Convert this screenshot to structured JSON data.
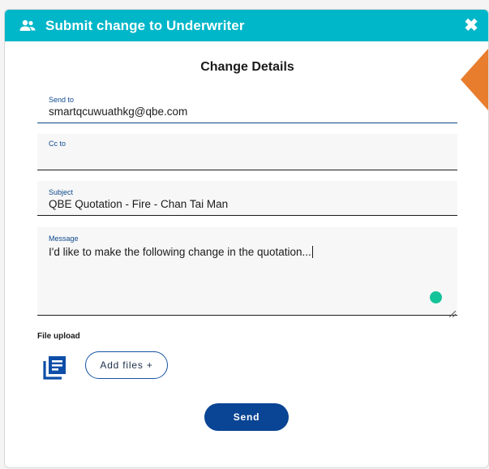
{
  "modal": {
    "title": "Submit change to Underwriter",
    "close_glyph": "✖",
    "header_color": "#00b6c9",
    "accent_color": "#e87d2e"
  },
  "form": {
    "section_title": "Change Details",
    "send_to": {
      "label": "Send to",
      "value": "smartqcuwuathkg@qbe.com"
    },
    "cc_to": {
      "label": "Cc to",
      "value": ""
    },
    "subject": {
      "label": "Subject",
      "value": "QBE Quotation - Fire - Chan Tai Man"
    },
    "message": {
      "label": "Message",
      "value": "I'd like to make the following change in the quotation..."
    }
  },
  "upload": {
    "label": "File upload",
    "add_files_label": "Add files +",
    "icon": "document-stack-icon"
  },
  "actions": {
    "send_label": "Send",
    "send_color": "#0a4494"
  }
}
